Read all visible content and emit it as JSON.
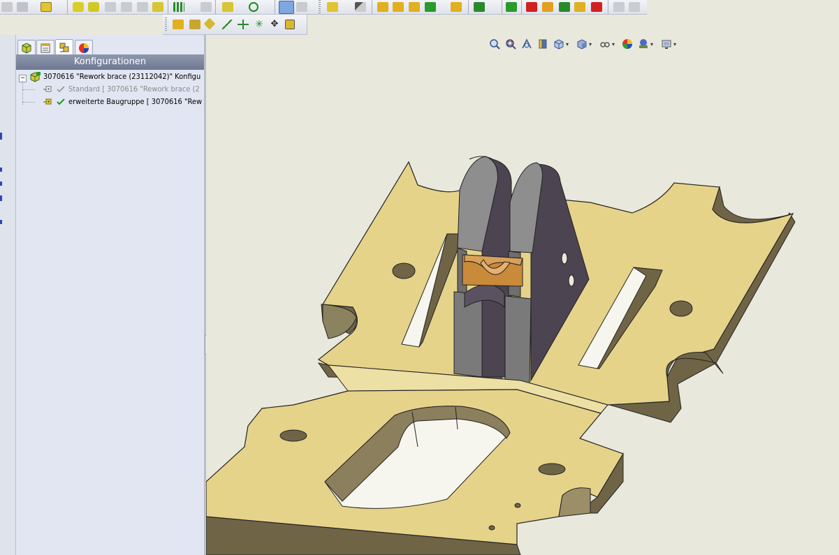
{
  "feature_manager": {
    "header_title": "Konfigurationen",
    "tabs": [
      {
        "name": "feature-manager-tab"
      },
      {
        "name": "property-manager-tab"
      },
      {
        "name": "configuration-manager-tab"
      },
      {
        "name": "display-manager-tab"
      }
    ],
    "tree": {
      "root_label": "3070616 \"Rework brace (23112042)\" Konfigu",
      "items": [
        {
          "label": "Standard [ 3070616 \"Rework brace (2",
          "active": false
        },
        {
          "label": "erweiterte Baugruppe [ 3070616 \"Rew",
          "active": true
        }
      ]
    }
  },
  "colors": {
    "viewport_bg": "#e9e8dc",
    "plate_top": "#e6d38a",
    "plate_side": "#6f6546",
    "block_dark": "#4c4450",
    "block_side": "#7a7a7a",
    "insert": "#c98a3a",
    "check_green": "#1c9a1c"
  }
}
